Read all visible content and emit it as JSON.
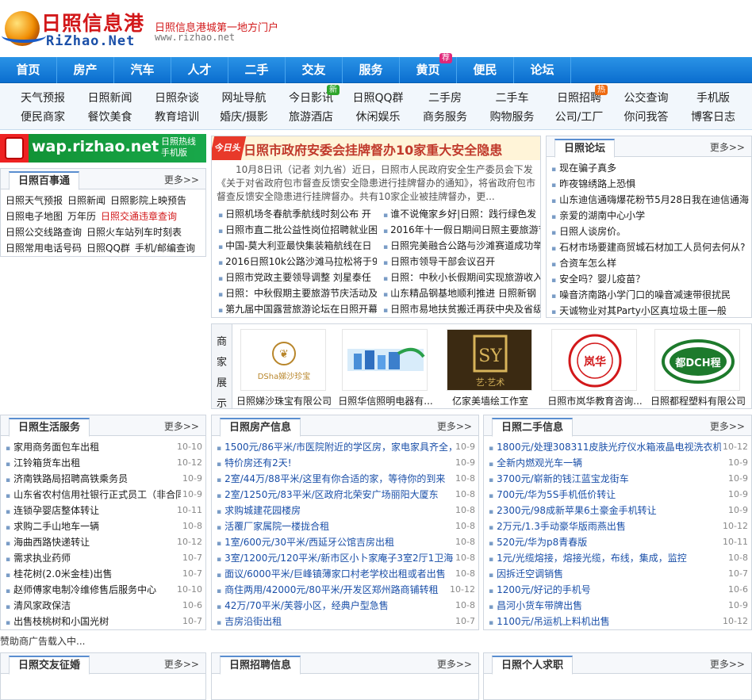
{
  "header": {
    "logo_cn": "日照信息港",
    "logo_en": "RiZhao.Net",
    "slogan": "日照信息港城第一地方门户",
    "url": "www.rizhao.net"
  },
  "main_nav": [
    {
      "label": "首页"
    },
    {
      "label": "房产"
    },
    {
      "label": "汽车"
    },
    {
      "label": "人才"
    },
    {
      "label": "二手"
    },
    {
      "label": "交友"
    },
    {
      "label": "服务"
    },
    {
      "label": "黄页",
      "badge": "荐"
    },
    {
      "label": "便民"
    },
    {
      "label": "论坛"
    }
  ],
  "sub_nav": {
    "row1": [
      {
        "label": "天气预报"
      },
      {
        "label": "日照新闻"
      },
      {
        "label": "日照杂谈"
      },
      {
        "label": "网址导航"
      },
      {
        "label": "今日影讯",
        "badge": "新"
      },
      {
        "label": "日照QQ群"
      },
      {
        "label": "二手房"
      },
      {
        "label": "二手车"
      },
      {
        "label": "日照招聘",
        "badge": "热"
      },
      {
        "label": "公交查询"
      },
      {
        "label": "手机版"
      }
    ],
    "row2": [
      {
        "label": "便民商家"
      },
      {
        "label": "餐饮美食"
      },
      {
        "label": "教育培训"
      },
      {
        "label": "婚庆/摄影"
      },
      {
        "label": "旅游酒店"
      },
      {
        "label": "休闲娱乐"
      },
      {
        "label": "商务服务"
      },
      {
        "label": "购物服务"
      },
      {
        "label": "公司/工厂"
      },
      {
        "label": "你问我答"
      },
      {
        "label": "博客日志"
      }
    ]
  },
  "wap": {
    "text": "wap.rizhao.net",
    "hot1": "日照热线",
    "hot2": "手机版"
  },
  "baishi": {
    "title": "日照百事通",
    "more": "更多>>",
    "rows": [
      [
        {
          "t": "日照天气预报"
        },
        {
          "t": "日照新闻"
        },
        {
          "t": "日照影院上映预告"
        }
      ],
      [
        {
          "t": "日照电子地图"
        },
        {
          "t": "万年历"
        },
        {
          "t": "日照交通违章查询",
          "red": true
        }
      ],
      [
        {
          "t": "日照公交线路查询"
        },
        {
          "t": "日照火车站列车时刻表"
        }
      ],
      [
        {
          "t": "日照常用电话号码"
        },
        {
          "t": "日照QQ群"
        },
        {
          "t": "手机/邮编查询"
        }
      ]
    ]
  },
  "news": {
    "ribbon": "今日头条",
    "headline": "日照市政府安委会挂牌督办10家重大安全隐患",
    "summary": "10月8日讯（记者 刘九省）近日，日照市人民政府安全生产委员会下发《关于对省政府包市督查反馈安全隐患进行挂牌督办的通知》，将省政府包市督查反馈安全隐患进行挂牌督办。共有10家企业被挂牌督办，更...",
    "rows": [
      [
        "日照机场冬春航季航线时刻公布 开",
        "谁不说俺家乡好|日照：践行绿色发"
      ],
      [
        "日照市直二批公益性岗位招聘就业困",
        "2016年十一假日期间日照主要旅游节"
      ],
      [
        "中国-莫大利亚最快集装箱航线在日",
        "日照完美融合公路与沙滩赛道成功举"
      ],
      [
        "2016日照10k公路沙滩马拉松将于9月",
        "日照市领导干部会议召开"
      ],
      [
        "日照市党政主要领导调整 刘星泰任",
        "日照：中秋小长假期间实现旅游收入"
      ],
      [
        "日照：中秋假期主要旅游节庆活动及",
        "山东精品钢基地顺利推进 日照新钢"
      ],
      [
        "第九届中国露营旅游论坛在日照开幕",
        "日照市易地扶贫搬迁再获中央及省级"
      ]
    ]
  },
  "forum": {
    "title": "日照论坛",
    "more": "更多>>",
    "items": [
      "现在骗子真多",
      "昨夜锦绣路上恐惧",
      "山东迪信通嗨爆花粉节5月28日我在迪信通海",
      "亲爱的湖南中心小学",
      "日照人谈房价。",
      "石材市场要建商贸城石材加工人员何去何从?",
      "合资车怎么样",
      "安全吗？婴儿疫苗？",
      "噪音济南路小学门口的噪音减速带很扰民",
      "天诚物业对其Party小区真垃圾土匪一般"
    ]
  },
  "showcase": {
    "label": "商家展示",
    "items": [
      {
        "name": "日照娣沙珠宝有限公司",
        "logo_text": "DSha娣沙珍宝"
      },
      {
        "name": "日照华信照明电器有...",
        "logo_text": ""
      },
      {
        "name": "亿家美墙绘工作室",
        "logo_text": "艺·艺术"
      },
      {
        "name": "日照市岚华教育咨询...",
        "logo_text": "岚华"
      },
      {
        "name": "日照都程塑料有限公司",
        "logo_text": "都DCH程"
      }
    ]
  },
  "life": {
    "title": "日照生活服务",
    "more": "更多>>",
    "items": [
      {
        "t": "家用商务面包车出租",
        "d": "10-10"
      },
      {
        "t": "江铃箱货车出租",
        "d": "10-12"
      },
      {
        "t": "济南铁路局招聘高铁乘务员",
        "d": "10-9"
      },
      {
        "t": "山东省农村信用社银行正式员工（非合同",
        "d": "10-9"
      },
      {
        "t": "连锁孕婴店整体转让",
        "d": "10-11"
      },
      {
        "t": "求购二手山地车一辆",
        "d": "10-8"
      },
      {
        "t": "海曲西路快递转让",
        "d": "10-12"
      },
      {
        "t": "需求执业药师",
        "d": "10-7"
      },
      {
        "t": "桂花树(2.0米金桂)出售",
        "d": "10-7"
      },
      {
        "t": "赵师傅家电制冷维修售后服务中心",
        "d": "10-10"
      },
      {
        "t": "清风家政保洁",
        "d": "10-6"
      },
      {
        "t": "出售枝桃树和小国光树",
        "d": "10-7"
      }
    ]
  },
  "house": {
    "title": "日照房产信息",
    "more": "更多>>",
    "items": [
      {
        "t": "1500元/86平米/市医院附近的学区房，家电家具齐全，",
        "d": "10-9"
      },
      {
        "t": "特价房还有2天!",
        "d": "10-9"
      },
      {
        "t": "2室/44万/88平米/这里有你合适的家，等待你的到来",
        "d": "10-8"
      },
      {
        "t": "2室/1250元/83平米/区政府北荣安广场丽阳大厦东",
        "d": "10-8"
      },
      {
        "t": "求购城建花园楼房",
        "d": "10-8"
      },
      {
        "t": "活覆厂家属院一楼拢合租",
        "d": "10-8"
      },
      {
        "t": "1室/600元/30平米/西延牙公馆吉房出租",
        "d": "10-8"
      },
      {
        "t": "3室/1200元/120平米/新市区小卜家庵子3室2厅1卫海景",
        "d": "10-8"
      },
      {
        "t": "面议/6000平米/巨峰镇薄家口村老学校出租或者出售",
        "d": "10-8"
      },
      {
        "t": "商住两用/42000元/80平米/开发区郑州路商铺转租",
        "d": "10-12"
      },
      {
        "t": "42万/70平米/芙蓉小区，经典户型急售",
        "d": "10-8"
      },
      {
        "t": "吉房沿街出租",
        "d": "10-7"
      }
    ]
  },
  "second": {
    "title": "日照二手信息",
    "more": "更多>>",
    "items": [
      {
        "t": "1800元/处理308311皮肤光疗仪水箱液晶电视洗衣机微",
        "d": "10-12"
      },
      {
        "t": "全新内燃观光车一辆",
        "d": "10-9"
      },
      {
        "t": "3700元/崭新的钱江蓝宝龙街车",
        "d": "10-9"
      },
      {
        "t": "700元/华为5S手机低价转让",
        "d": "10-9"
      },
      {
        "t": "2300元/98成新苹果6土豪金手机转让",
        "d": "10-9"
      },
      {
        "t": "2万元/1.3手动豪华版雨燕出售",
        "d": "10-12"
      },
      {
        "t": "520元/华为p8青春版",
        "d": "10-11"
      },
      {
        "t": "1元/光缆熔接，熔接光缆，布线，集成，监控",
        "d": "10-8"
      },
      {
        "t": "因拆迁空调销售",
        "d": "10-7"
      },
      {
        "t": "1200元/好记的手机号",
        "d": "10-6"
      },
      {
        "t": "昌河小货车带牌出售",
        "d": "10-9"
      },
      {
        "t": "1100元/吊运机上料机出售",
        "d": "10-12"
      }
    ]
  },
  "sponsor": "赞助商广告载入中...",
  "bottom_boxes": {
    "friend": {
      "title": "日照交友征婚",
      "more": "更多>>"
    },
    "job": {
      "title": "日照招聘信息",
      "more": "更多>>"
    },
    "want": {
      "title": "日照个人求职",
      "more": "更多>>"
    }
  },
  "colors": {
    "nav_blue": "#0b6ecf",
    "brand_red": "#d2181a",
    "wap_green": "#129336"
  }
}
